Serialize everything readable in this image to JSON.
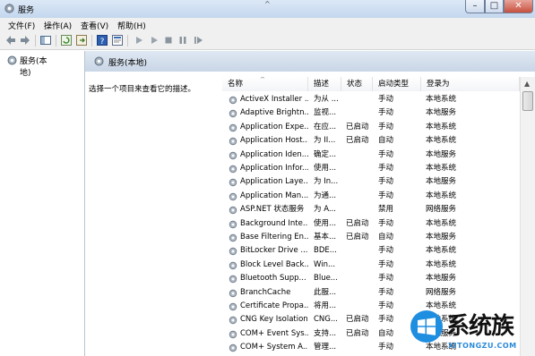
{
  "window": {
    "title": "服务",
    "caption_arrow": "^"
  },
  "menubar": [
    "文件(F)",
    "操作(A)",
    "查看(V)",
    "帮助(H)"
  ],
  "tree": {
    "root_label": "服务(本地)"
  },
  "header": {
    "label": "服务(本地)"
  },
  "description": {
    "text": "选择一个项目来查看它的描述。"
  },
  "table": {
    "columns": [
      "名称",
      "描述",
      "状态",
      "启动类型",
      "登录为"
    ],
    "rows": [
      {
        "name": "ActiveX Installer ...",
        "desc": "为从 ...",
        "status": "",
        "startup": "手动",
        "logon": "本地系统"
      },
      {
        "name": "Adaptive Brightn...",
        "desc": "监视...",
        "status": "",
        "startup": "手动",
        "logon": "本地服务"
      },
      {
        "name": "Application Expe...",
        "desc": "在应...",
        "status": "已启动",
        "startup": "手动",
        "logon": "本地系统"
      },
      {
        "name": "Application Host...",
        "desc": "为 II...",
        "status": "已启动",
        "startup": "自动",
        "logon": "本地系统"
      },
      {
        "name": "Application Iden...",
        "desc": "确定...",
        "status": "",
        "startup": "手动",
        "logon": "本地服务"
      },
      {
        "name": "Application Infor...",
        "desc": "使用...",
        "status": "",
        "startup": "手动",
        "logon": "本地系统"
      },
      {
        "name": "Application Laye...",
        "desc": "为 In...",
        "status": "",
        "startup": "手动",
        "logon": "本地服务"
      },
      {
        "name": "Application Man...",
        "desc": "为通...",
        "status": "",
        "startup": "手动",
        "logon": "本地系统"
      },
      {
        "name": "ASP.NET 状态服务",
        "desc": "为 A...",
        "status": "",
        "startup": "禁用",
        "logon": "网络服务"
      },
      {
        "name": "Background Inte...",
        "desc": "使用...",
        "status": "已启动",
        "startup": "手动",
        "logon": "本地系统"
      },
      {
        "name": "Base Filtering En...",
        "desc": "基本...",
        "status": "已启动",
        "startup": "自动",
        "logon": "本地服务"
      },
      {
        "name": "BitLocker Drive ...",
        "desc": "BDE...",
        "status": "",
        "startup": "手动",
        "logon": "本地系统"
      },
      {
        "name": "Block Level Back...",
        "desc": "Win...",
        "status": "",
        "startup": "手动",
        "logon": "本地系统"
      },
      {
        "name": "Bluetooth Supp...",
        "desc": "Blue...",
        "status": "",
        "startup": "手动",
        "logon": "本地服务"
      },
      {
        "name": "BranchCache",
        "desc": "此服...",
        "status": "",
        "startup": "手动",
        "logon": "网络服务"
      },
      {
        "name": "Certificate Propa...",
        "desc": "将用...",
        "status": "",
        "startup": "手动",
        "logon": "本地系统"
      },
      {
        "name": "CNG Key Isolation",
        "desc": "CNG...",
        "status": "已启动",
        "startup": "手动",
        "logon": "本地系统"
      },
      {
        "name": "COM+ Event Sys...",
        "desc": "支持...",
        "status": "已启动",
        "startup": "自动",
        "logon": "本地服务"
      },
      {
        "name": "COM+ System A...",
        "desc": "管理...",
        "status": "",
        "startup": "手动",
        "logon": "本地系统"
      }
    ]
  },
  "watermark": {
    "text": "系统族",
    "url": "XITONGZU.COM"
  },
  "colors": {
    "header_band": "#c9d6e6",
    "titlebar": "#c4d7ee",
    "accent": "#2a8ad8"
  }
}
